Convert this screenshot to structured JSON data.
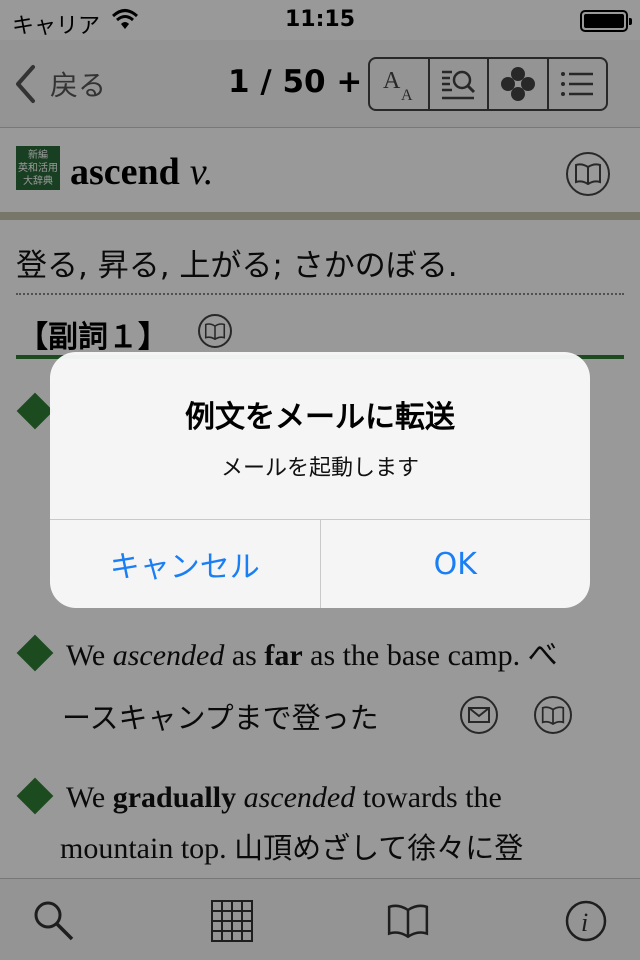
{
  "status_bar": {
    "carrier": "キャリア",
    "time": "11:15"
  },
  "nav": {
    "back_label": "戻る",
    "counter": "1 / 50 +"
  },
  "entry": {
    "dict_logo": [
      "新編",
      "英和活用",
      "大辞典"
    ],
    "headword": "ascend",
    "pos": "v.",
    "definition": "登る, 昇る, 上がる; さかのぼる.",
    "sense_label": "【副詞１】"
  },
  "examples": [
    {
      "parts": [
        "We ",
        "ascended",
        " as ",
        "far",
        " as the base camp. べ"
      ],
      "line2": "ースキャンプまで登った"
    },
    {
      "parts": [
        "We ",
        "gradually",
        " ",
        "ascended",
        " towards the"
      ],
      "line2_en": "mountain top. ",
      "line2_jp": "山頂めざして徐々に登"
    }
  ],
  "alert": {
    "title": "例文をメールに転送",
    "message": "メールを起動します",
    "cancel_label": "キャンセル",
    "ok_label": "OK"
  },
  "colors": {
    "accent": "#1a7ef5",
    "green": "#2e7d32"
  }
}
